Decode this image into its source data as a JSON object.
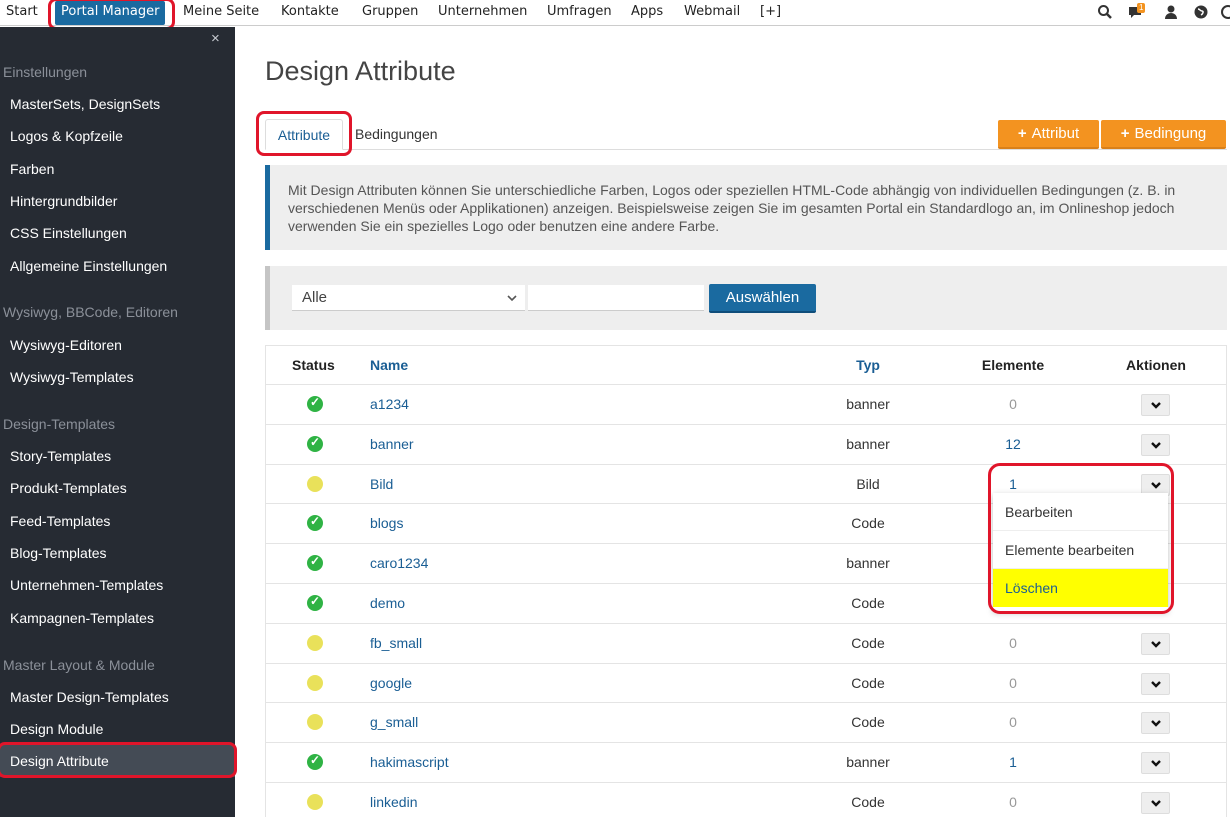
{
  "topnav": {
    "items": [
      "Start",
      "Portal Manager",
      "Meine Seite",
      "Kontakte",
      "Gruppen",
      "Unternehmen",
      "Umfragen",
      "Apps",
      "Webmail",
      "[+]"
    ],
    "badge": "1",
    "icons": [
      "search-icon",
      "messages-icon",
      "user-icon",
      "globe-icon"
    ]
  },
  "sidebar": {
    "close": "×",
    "sections": [
      {
        "title": "Einstellungen",
        "items": [
          "MasterSets, DesignSets",
          "Logos & Kopfzeile",
          "Farben",
          "Hintergrundbilder",
          "CSS Einstellungen",
          "Allgemeine Einstellungen"
        ]
      },
      {
        "title": "Wysiwyg, BBCode, Editoren",
        "items": [
          "Wysiwyg-Editoren",
          "Wysiwyg-Templates"
        ]
      },
      {
        "title": "Design-Templates",
        "items": [
          "Story-Templates",
          "Produkt-Templates",
          "Feed-Templates",
          "Blog-Templates",
          "Unternehmen-Templates",
          "Kampagnen-Templates"
        ]
      },
      {
        "title": "Master Layout & Module",
        "items": [
          "Master Design-Templates",
          "Design Module",
          "Design Attribute"
        ]
      }
    ]
  },
  "main": {
    "title": "Design Attribute",
    "tabs": [
      "Attribute",
      "Bedingungen"
    ],
    "buttons": {
      "add_attribute": "Attribut",
      "add_condition": "Bedingung"
    },
    "info": "Mit Design Attributen können Sie unterschiedliche Farben, Logos oder speziellen HTML-Code abhängig von individuellen Bedingungen (z. B. in verschiedenen Menüs oder Applikationen) anzeigen. Beispielsweise zeigen Sie im gesamten Portal ein Standardlogo an, im Onlineshop jedoch verwenden Sie ein spezielles Logo oder benutzen eine andere Farbe.",
    "filter": {
      "select_value": "Alle",
      "input_value": "",
      "button": "Auswählen"
    }
  },
  "table": {
    "headers": {
      "status": "Status",
      "name": "Name",
      "type": "Typ",
      "elements": "Elemente",
      "actions": "Aktionen"
    },
    "rows": [
      {
        "status": "ok",
        "name": "a1234",
        "type": "banner",
        "elements": "0"
      },
      {
        "status": "ok",
        "name": "banner",
        "type": "banner",
        "elements": "12"
      },
      {
        "status": "warn",
        "name": "Bild",
        "type": "Bild",
        "elements": "1"
      },
      {
        "status": "ok",
        "name": "blogs",
        "type": "Code",
        "elements": ""
      },
      {
        "status": "ok",
        "name": "caro1234",
        "type": "banner",
        "elements": ""
      },
      {
        "status": "ok",
        "name": "demo",
        "type": "Code",
        "elements": ""
      },
      {
        "status": "warn",
        "name": "fb_small",
        "type": "Code",
        "elements": "0"
      },
      {
        "status": "warn",
        "name": "google",
        "type": "Code",
        "elements": "0"
      },
      {
        "status": "warn",
        "name": "g_small",
        "type": "Code",
        "elements": "0"
      },
      {
        "status": "ok",
        "name": "hakimascript",
        "type": "banner",
        "elements": "1"
      },
      {
        "status": "warn",
        "name": "linkedin",
        "type": "Code",
        "elements": "0"
      }
    ]
  },
  "dropdown": {
    "items": [
      "Bearbeiten",
      "Elemente bearbeiten",
      "Löschen"
    ]
  },
  "colors": {
    "accent": "#1a6aa0",
    "orange": "#f39320",
    "sidebar": "#262b33",
    "highlight": "#e0152a"
  }
}
